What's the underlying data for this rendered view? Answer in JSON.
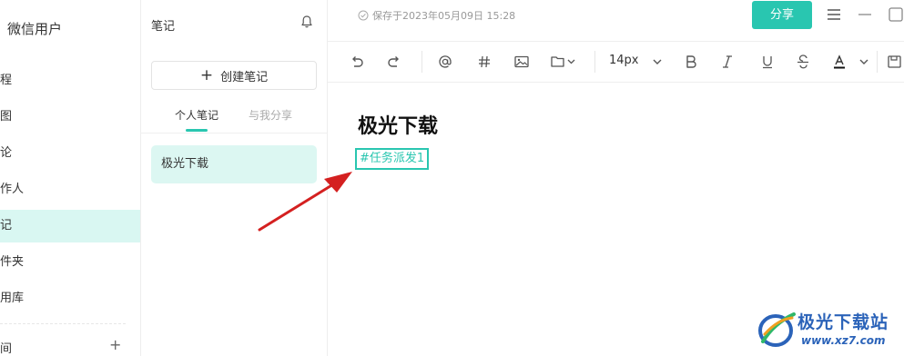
{
  "nav": {
    "user_name": "微信用户",
    "items": [
      {
        "label": "程"
      },
      {
        "label": "图"
      },
      {
        "label": "论"
      },
      {
        "label": "作人"
      },
      {
        "label": "记",
        "active": true
      },
      {
        "label": "件夹"
      },
      {
        "label": "用库"
      }
    ],
    "bottom_label": "间",
    "add_symbol": "+"
  },
  "list": {
    "title": "笔记",
    "create_label": "创建笔记",
    "create_symbol": "+",
    "tabs": [
      {
        "label": "个人笔记",
        "active": true
      },
      {
        "label": "与我分享",
        "active": false
      }
    ],
    "notes": [
      {
        "title": "极光下载",
        "selected": true
      }
    ]
  },
  "editor": {
    "saved_status": "保存于2023年05月09日 15:28",
    "share_label": "分享",
    "toolbar": {
      "font_size": "14px",
      "icons": [
        "undo-icon",
        "redo-icon",
        "mention-icon",
        "hashtag-icon",
        "image-icon",
        "folder-icon",
        "font-size-dropdown",
        "bold-icon",
        "italic-icon",
        "underline-icon",
        "strikethrough-icon",
        "font-color-icon"
      ]
    },
    "doc_title": "极光下载",
    "tag": "#任务派发1"
  },
  "watermark": {
    "name": "极光下载站",
    "url": "www.xz7.com"
  },
  "colors": {
    "accent": "#29c6b0",
    "active_bg": "#d9f7f2",
    "arrow": "#d42020",
    "watermark": "#2b63b9"
  }
}
